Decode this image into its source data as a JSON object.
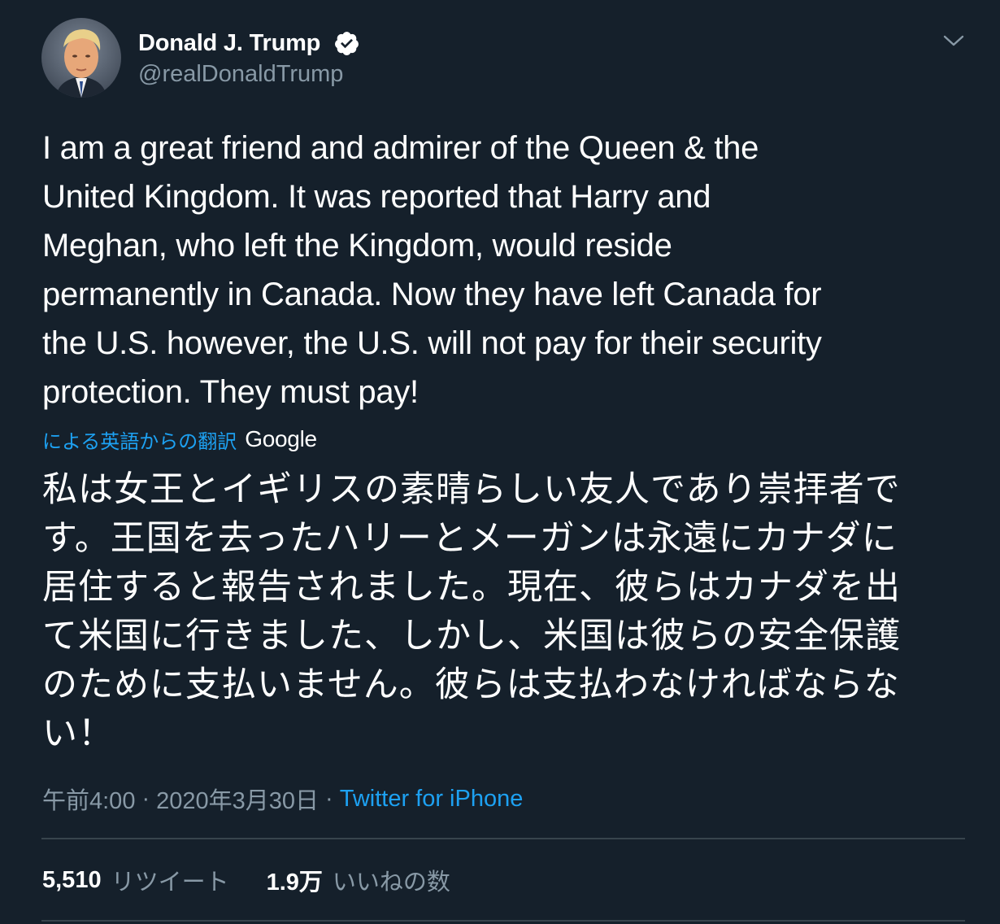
{
  "tweet": {
    "author": {
      "display_name": "Donald J. Trump",
      "handle": "@realDonaldTrump",
      "verified_icon": "verified-badge-icon",
      "avatar": "profile-photo"
    },
    "menu_icon": "chevron-down-icon",
    "text": "I am a great friend and admirer of the Queen & the\nUnited Kingdom. It was reported that Harry and\nMeghan, who left the Kingdom, would reside\npermanently in Canada. Now they have left Canada for\nthe U.S. however, the U.S. will not pay for their security\nprotection. They must pay!",
    "translation": {
      "label": "による英語からの翻訳",
      "provider": "Google",
      "text": "私は女王とイギリスの素晴らしい友人であり崇拝者で\nす。王国を去ったハリーとメーガンは永遠にカナダに\n居住すると報告されました。現在、彼らはカナダを出\nて米国に行きました、しかし、米国は彼らの安全保護\nのために支払いません。彼らは支払わなければならな\nい！"
    },
    "meta": {
      "time": "午前4:00",
      "separator": "·",
      "date": "2020年3月30日",
      "source": "Twitter for iPhone"
    },
    "stats": {
      "retweets": {
        "count": "5,510",
        "label": "リツイート"
      },
      "likes": {
        "count": "1.9万",
        "label": "いいねの数"
      }
    },
    "colors": {
      "background": "#15202b",
      "text": "#ffffff",
      "secondary": "#8899a6",
      "accent": "#1da1f2",
      "divider": "#38444d"
    }
  }
}
